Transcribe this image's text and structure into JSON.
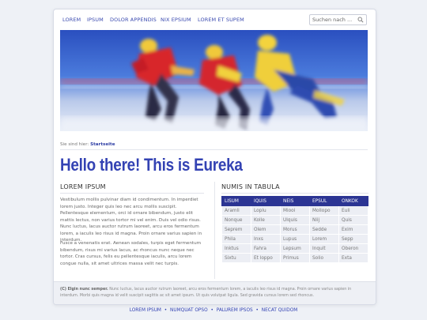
{
  "nav": {
    "items": [
      "LOREM",
      "IPSUM",
      "DOLOR APPENDIS",
      "NIX EPSIUM",
      "LOREM ET SUPEM"
    ],
    "search_placeholder": "Suchen nach ..."
  },
  "hero": {
    "icon": "speed-skaters-photo"
  },
  "breadcrumb": {
    "prefix": "Sie sind hier:",
    "current": "Startseite"
  },
  "main": {
    "title": "Hello there! This is Eureka"
  },
  "left": {
    "heading": "LOREM IPSUM",
    "p1": "Vestibulum mollis pulvinar diam id condimentum. In imperdiet lorem justo. Integer quis leo nec arcu mollis suscipit. Pellentesque elementum, orci id ornare bibendum, justo elit mattis lectus, non varius tortor mi vel enim. Duis vel odio risus. Nunc luctus, lacus auctor rutrum laoreet, arcu eros fermentum lorem, a iaculis leo risus id magna. Proin ornare varius sapien in interdum.",
    "p2": "Fusce a venenatis erat. Aenean sodales, turpis eget fermentum bibendum, risus mi varius lacus, ac rhoncus nunc neque nec tortor. Cras cursus, felis eu pellentesque iaculis, arcu lorem congue nulla, sit amet ultrices massa velit nec turpis."
  },
  "right": {
    "heading": "NUMIS IN TABULA",
    "columns": [
      "LISUM",
      "IQUIS",
      "NEIS",
      "EPSUL",
      "ONKOK"
    ],
    "rows": [
      [
        "Aramli",
        "Loplu",
        "Miooi",
        "Mollopo",
        "Euli"
      ],
      [
        "Nonque",
        "Kolle",
        "Ulquis",
        "Niij",
        "Quis"
      ],
      [
        "Seprem",
        "Olem",
        "Morus",
        "Sedde",
        "Exim"
      ],
      [
        "Phila",
        "Inxs",
        "Lupus",
        "Lorem",
        "Sepp"
      ],
      [
        "Inktus",
        "Fahra",
        "Lepsum",
        "Inquit",
        "Oberon"
      ],
      [
        "Sixtu",
        "Et loppo",
        "Primus",
        "Solio",
        "Exta"
      ]
    ]
  },
  "footer": {
    "lead": "(C) Elgin nunc semper.",
    "text": "Nunc luctus, lacus auctor rutrum laoreet, arcu eros fermentum lorem, a iaculis leo risus id magna. Proin ornare varius sapien in interdum. Morbi quis magna id velit suscipit sagittis ac sit amet ipsum. Ut quis volutpat ligula. Sed gravida cursus lorem sed rhoncus."
  },
  "bottom_links": [
    "LOREM IPSUM",
    "NUMQUAT OPSO",
    "PALUREM IPSOS",
    "NECAT QUIDOM"
  ],
  "bottom_sep": "•",
  "colors": {
    "accent": "#3342b3",
    "table_header": "#2b3493",
    "background": "#eef1f6"
  }
}
